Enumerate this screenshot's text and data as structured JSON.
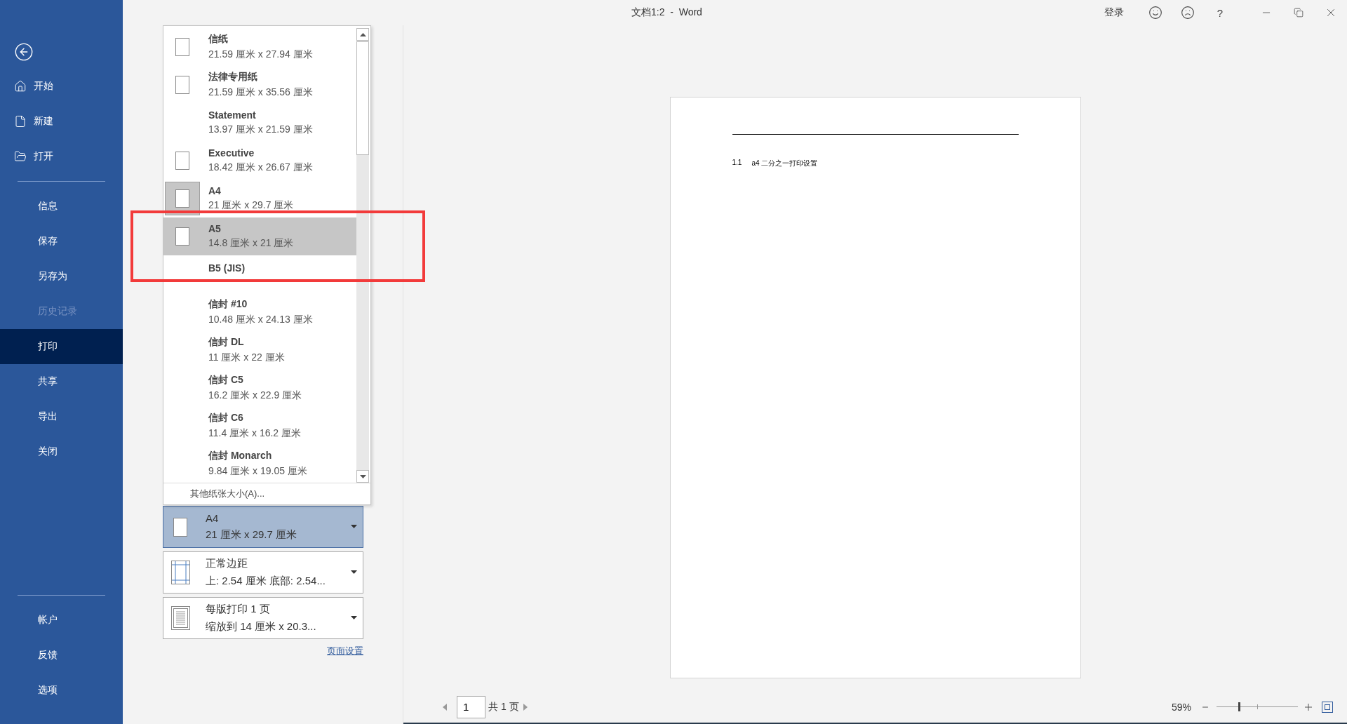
{
  "window": {
    "title": "文档1:2  -  Word",
    "sign_in": "登录",
    "help": "?"
  },
  "sidebar": {
    "top": [
      {
        "label": "开始",
        "kind": "home",
        "selected": false,
        "disabled": false
      },
      {
        "label": "新建",
        "kind": "file",
        "selected": false,
        "disabled": false
      },
      {
        "label": "打开",
        "kind": "folder",
        "selected": false,
        "disabled": false
      }
    ],
    "middle": [
      {
        "label": "信息",
        "kind": "text",
        "selected": false,
        "disabled": false
      },
      {
        "label": "保存",
        "kind": "text",
        "selected": false,
        "disabled": false
      },
      {
        "label": "另存为",
        "kind": "text",
        "selected": false,
        "disabled": false
      },
      {
        "label": "历史记录",
        "kind": "text",
        "selected": false,
        "disabled": true
      },
      {
        "label": "打印",
        "kind": "text",
        "selected": true,
        "disabled": false
      },
      {
        "label": "共享",
        "kind": "text",
        "selected": false,
        "disabled": false
      },
      {
        "label": "导出",
        "kind": "text",
        "selected": false,
        "disabled": false
      },
      {
        "label": "关闭",
        "kind": "text",
        "selected": false,
        "disabled": false
      }
    ],
    "bottom": [
      {
        "label": "帐户",
        "kind": "text",
        "selected": false,
        "disabled": false
      },
      {
        "label": "反馈",
        "kind": "text",
        "selected": false,
        "disabled": false
      },
      {
        "label": "选项",
        "kind": "text",
        "selected": false,
        "disabled": false
      }
    ]
  },
  "paper_menu": {
    "items": [
      {
        "name": "信纸",
        "size": "21.59 厘米 x 27.94 厘米",
        "kind": "icon",
        "selected": false,
        "hovered": false
      },
      {
        "name": "法律专用纸",
        "size": "21.59 厘米 x 35.56 厘米",
        "kind": "icon",
        "selected": false,
        "hovered": false
      },
      {
        "name": "Statement",
        "size": "13.97 厘米 x 21.59 厘米",
        "kind": "plain",
        "selected": false,
        "hovered": false
      },
      {
        "name": "Executive",
        "size": "18.42 厘米 x 26.67 厘米",
        "kind": "icon",
        "selected": false,
        "hovered": false
      },
      {
        "name": "A4",
        "size": "21 厘米 x 29.7 厘米",
        "kind": "icon",
        "selected": true,
        "hovered": false
      },
      {
        "name": "A5",
        "size": "14.8 厘米 x 21 厘米",
        "kind": "icon",
        "selected": false,
        "hovered": true
      },
      {
        "name": "B5 (JIS)",
        "kind": "plain",
        "selected": false,
        "hovered": false
      },
      {
        "name": "信封 #10",
        "size": "10.48 厘米 x 24.13 厘米",
        "kind": "plain",
        "selected": false,
        "hovered": false
      },
      {
        "name": "信封 DL",
        "size": "11 厘米 x 22 厘米",
        "kind": "plain",
        "selected": false,
        "hovered": false
      },
      {
        "name": "信封 C5",
        "size": "16.2 厘米 x 22.9 厘米",
        "kind": "plain",
        "selected": false,
        "hovered": false
      },
      {
        "name": "信封 C6",
        "size": "11.4 厘米 x 16.2 厘米",
        "kind": "plain",
        "selected": false,
        "hovered": false
      },
      {
        "name": "信封 Monarch",
        "size": "9.84 厘米 x 19.05 厘米",
        "kind": "plain",
        "selected": false,
        "hovered": false
      }
    ],
    "more": "其他纸张大小(A)..."
  },
  "settings": [
    {
      "kind": "paper",
      "title": "A4",
      "detail": "21 厘米 x 29.7 厘米",
      "selected": true
    },
    {
      "kind": "margins",
      "title": "正常边距",
      "detail": "上: 2.54 厘米 底部: 2.54...",
      "selected": false
    },
    {
      "kind": "pages",
      "title": "每版打印 1 页",
      "detail": "缩放到 14 厘米 x 20.3...",
      "selected": false
    }
  ],
  "page_setup_link": "页面设置",
  "preview": {
    "heading_number": "1.1",
    "heading_text": "a4 二分之一打印设置"
  },
  "status_bar": {
    "page": "1",
    "page_total": "共 1 页",
    "zoom": "59%",
    "zoom_slider": {
      "level": 0.28
    }
  }
}
